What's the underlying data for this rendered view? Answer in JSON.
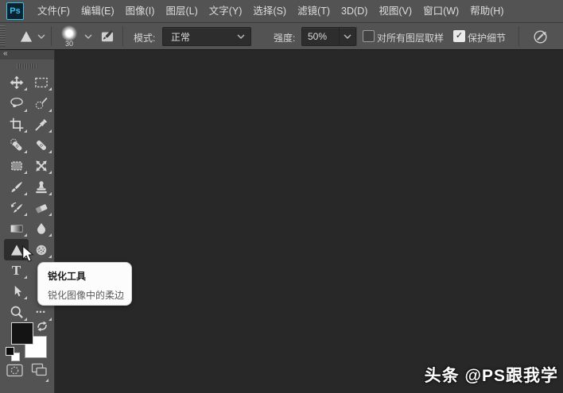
{
  "app": {
    "logo_text": "Ps"
  },
  "menubar": {
    "items": [
      "文件(F)",
      "编辑(E)",
      "图像(I)",
      "图层(L)",
      "文字(Y)",
      "选择(S)",
      "滤镜(T)",
      "3D(D)",
      "视图(V)",
      "窗口(W)",
      "帮助(H)"
    ]
  },
  "options_bar": {
    "brush_size": "30",
    "mode_label": "模式:",
    "mode_value": "正常",
    "strength_label": "强度:",
    "strength_value": "50%",
    "sample_all_layers_label": "对所有图层取样",
    "sample_all_layers_checked": false,
    "protect_detail_label": "保护细节",
    "protect_detail_checked": true,
    "check_glyph": "✓"
  },
  "toolbar": {
    "collapse_glyph": "«",
    "type_tool_glyph": "T",
    "more_tools_glyph": "•••",
    "selected_tool": "sharpen-tool",
    "tools": [
      "move-tool",
      "rectangular-marquee-tool",
      "lasso-tool",
      "quick-selection-tool",
      "crop-tool",
      "eyedropper-tool",
      "spot-healing-brush-tool",
      "healing-brush-tool",
      "patch-tool",
      "content-aware-move-tool",
      "brush-tool",
      "clone-stamp-tool",
      "history-brush-tool",
      "eraser-tool",
      "gradient-tool",
      "blur-tool",
      "sharpen-tool",
      "sponge-tool",
      "type-tool",
      "path-selection-tool",
      "zoom-tool",
      "edit-toolbar"
    ],
    "foreground_color": "#000000",
    "background_color": "#ffffff"
  },
  "tooltip": {
    "title": "锐化工具",
    "description": "锐化图像中的柔边"
  },
  "watermark": "头条 @PS跟我学",
  "colors": {
    "panel": "#535353",
    "canvas": "#282828",
    "input_bg": "#2d2d2d",
    "text": "#dcdcdc",
    "logo_accent": "#2fc3f0",
    "tooltip_bg": "#fcfcfc"
  }
}
